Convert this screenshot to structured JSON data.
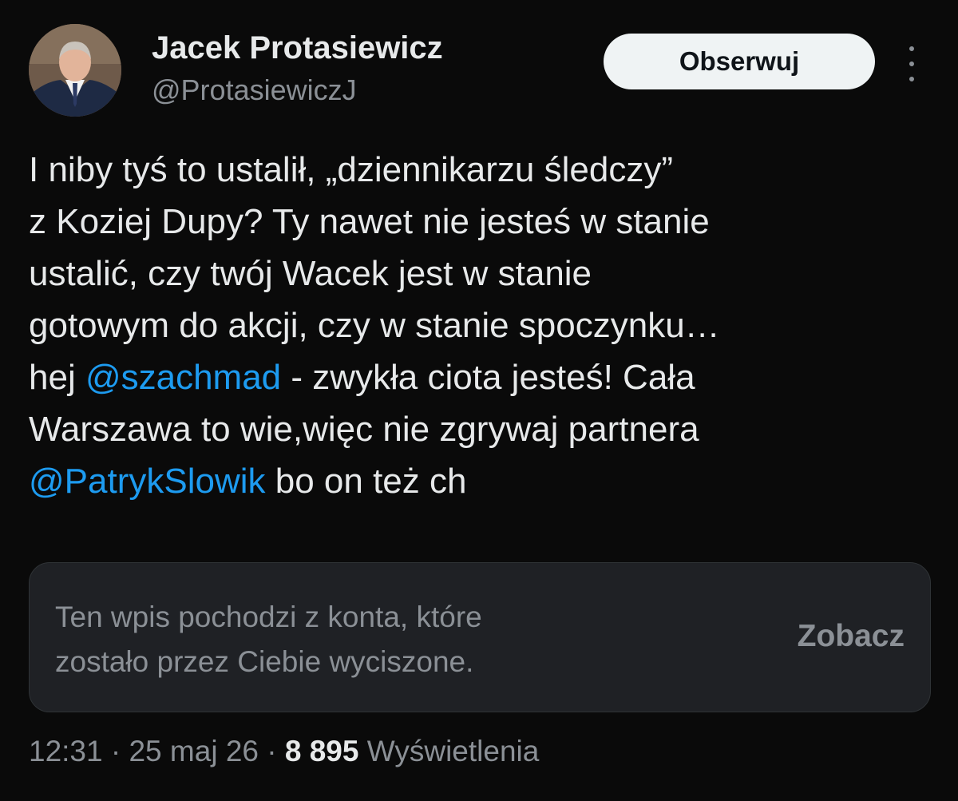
{
  "author": {
    "display_name": "Jacek Protasiewicz",
    "handle": "@ProtasiewiczJ"
  },
  "header": {
    "follow_label": "Obserwuj",
    "more_icon": "more-vertical-icon"
  },
  "tweet": {
    "lines": [
      [
        {
          "text": "I niby tyś to ustalił, „dziennikarzu śledczy”"
        }
      ],
      [
        {
          "text": "z Koziej Dupy? Ty nawet nie jesteś w stanie"
        }
      ],
      [
        {
          "text": "ustalić, czy twój Wacek jest w stanie"
        }
      ],
      [
        {
          "text": "gotowym do akcji, czy w stanie spoczynku…"
        }
      ],
      [
        {
          "text": "hej "
        },
        {
          "text": "@szachmad",
          "mention": true
        },
        {
          "text": " - zwykła ciota jesteś! Cała"
        }
      ],
      [
        {
          "text": "Warszawa to wie,więc nie zgrywaj partnera"
        }
      ],
      [
        {
          "text": "@PatrykSlowik",
          "mention": true
        },
        {
          "text": " bo on też ch"
        }
      ]
    ]
  },
  "muted_notice": {
    "line1": "Ten wpis pochodzi z konta, które",
    "line2": "zostało przez Ciebie wyciszone.",
    "view_label": "Zobacz"
  },
  "meta": {
    "time": "12:31",
    "separator": " · ",
    "date": "25 maj 26",
    "views_count": "8 895",
    "views_label": " Wyświetlenia"
  },
  "colors": {
    "background": "#0a0a0a",
    "text": "#e7e9ea",
    "secondary": "#8b9096",
    "mention": "#1d9bf0",
    "follow_button_bg": "#eff3f4"
  }
}
